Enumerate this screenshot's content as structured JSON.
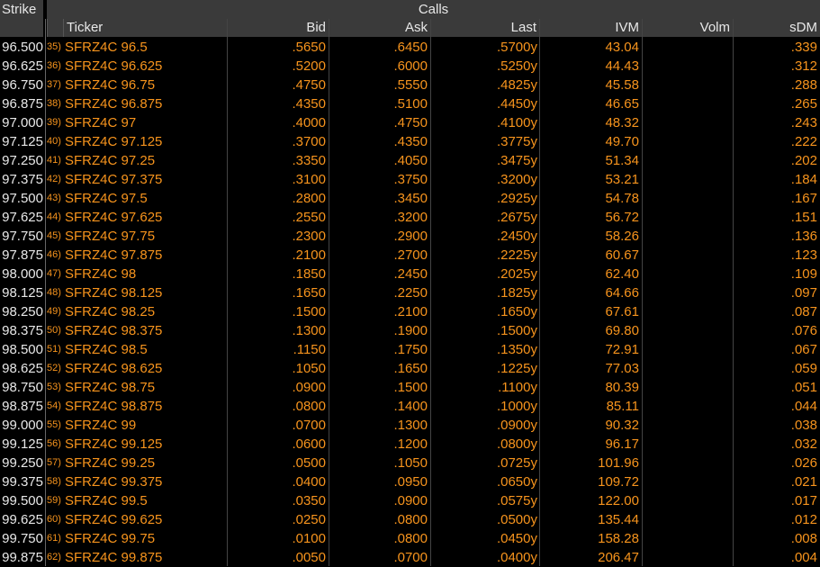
{
  "header": {
    "strike_label": "Strike",
    "calls_label": "Calls",
    "columns": {
      "ticker": "Ticker",
      "bid": "Bid",
      "ask": "Ask",
      "last": "Last",
      "ivm": "IVM",
      "volm": "Volm",
      "sdm": "sDM"
    }
  },
  "colors": {
    "header_bg": "#3a3a3a",
    "data": "#f7941d",
    "strike": "#e8e8e8",
    "background": "#000000"
  },
  "rows": [
    {
      "strike": "96.500",
      "num": "35)",
      "ticker": "SFRZ4C 96.5",
      "bid": ".5650",
      "ask": ".6450",
      "last": ".5700y",
      "ivm": "43.04",
      "volm": "",
      "sdm": ".339"
    },
    {
      "strike": "96.625",
      "num": "36)",
      "ticker": "SFRZ4C 96.625",
      "bid": ".5200",
      "ask": ".6000",
      "last": ".5250y",
      "ivm": "44.43",
      "volm": "",
      "sdm": ".312"
    },
    {
      "strike": "96.750",
      "num": "37)",
      "ticker": "SFRZ4C 96.75",
      "bid": ".4750",
      "ask": ".5550",
      "last": ".4825y",
      "ivm": "45.58",
      "volm": "",
      "sdm": ".288"
    },
    {
      "strike": "96.875",
      "num": "38)",
      "ticker": "SFRZ4C 96.875",
      "bid": ".4350",
      "ask": ".5100",
      "last": ".4450y",
      "ivm": "46.65",
      "volm": "",
      "sdm": ".265"
    },
    {
      "strike": "97.000",
      "num": "39)",
      "ticker": "SFRZ4C 97",
      "bid": ".4000",
      "ask": ".4750",
      "last": ".4100y",
      "ivm": "48.32",
      "volm": "",
      "sdm": ".243"
    },
    {
      "strike": "97.125",
      "num": "40)",
      "ticker": "SFRZ4C 97.125",
      "bid": ".3700",
      "ask": ".4350",
      "last": ".3775y",
      "ivm": "49.70",
      "volm": "",
      "sdm": ".222"
    },
    {
      "strike": "97.250",
      "num": "41)",
      "ticker": "SFRZ4C 97.25",
      "bid": ".3350",
      "ask": ".4050",
      "last": ".3475y",
      "ivm": "51.34",
      "volm": "",
      "sdm": ".202"
    },
    {
      "strike": "97.375",
      "num": "42)",
      "ticker": "SFRZ4C 97.375",
      "bid": ".3100",
      "ask": ".3750",
      "last": ".3200y",
      "ivm": "53.21",
      "volm": "",
      "sdm": ".184"
    },
    {
      "strike": "97.500",
      "num": "43)",
      "ticker": "SFRZ4C 97.5",
      "bid": ".2800",
      "ask": ".3450",
      "last": ".2925y",
      "ivm": "54.78",
      "volm": "",
      "sdm": ".167"
    },
    {
      "strike": "97.625",
      "num": "44)",
      "ticker": "SFRZ4C 97.625",
      "bid": ".2550",
      "ask": ".3200",
      "last": ".2675y",
      "ivm": "56.72",
      "volm": "",
      "sdm": ".151"
    },
    {
      "strike": "97.750",
      "num": "45)",
      "ticker": "SFRZ4C 97.75",
      "bid": ".2300",
      "ask": ".2900",
      "last": ".2450y",
      "ivm": "58.26",
      "volm": "",
      "sdm": ".136"
    },
    {
      "strike": "97.875",
      "num": "46)",
      "ticker": "SFRZ4C 97.875",
      "bid": ".2100",
      "ask": ".2700",
      "last": ".2225y",
      "ivm": "60.67",
      "volm": "",
      "sdm": ".123"
    },
    {
      "strike": "98.000",
      "num": "47)",
      "ticker": "SFRZ4C 98",
      "bid": ".1850",
      "ask": ".2450",
      "last": ".2025y",
      "ivm": "62.40",
      "volm": "",
      "sdm": ".109"
    },
    {
      "strike": "98.125",
      "num": "48)",
      "ticker": "SFRZ4C 98.125",
      "bid": ".1650",
      "ask": ".2250",
      "last": ".1825y",
      "ivm": "64.66",
      "volm": "",
      "sdm": ".097"
    },
    {
      "strike": "98.250",
      "num": "49)",
      "ticker": "SFRZ4C 98.25",
      "bid": ".1500",
      "ask": ".2100",
      "last": ".1650y",
      "ivm": "67.61",
      "volm": "",
      "sdm": ".087"
    },
    {
      "strike": "98.375",
      "num": "50)",
      "ticker": "SFRZ4C 98.375",
      "bid": ".1300",
      "ask": ".1900",
      "last": ".1500y",
      "ivm": "69.80",
      "volm": "",
      "sdm": ".076"
    },
    {
      "strike": "98.500",
      "num": "51)",
      "ticker": "SFRZ4C 98.5",
      "bid": ".1150",
      "ask": ".1750",
      "last": ".1350y",
      "ivm": "72.91",
      "volm": "",
      "sdm": ".067"
    },
    {
      "strike": "98.625",
      "num": "52)",
      "ticker": "SFRZ4C 98.625",
      "bid": ".1050",
      "ask": ".1650",
      "last": ".1225y",
      "ivm": "77.03",
      "volm": "",
      "sdm": ".059"
    },
    {
      "strike": "98.750",
      "num": "53)",
      "ticker": "SFRZ4C 98.75",
      "bid": ".0900",
      "ask": ".1500",
      "last": ".1100y",
      "ivm": "80.39",
      "volm": "",
      "sdm": ".051"
    },
    {
      "strike": "98.875",
      "num": "54)",
      "ticker": "SFRZ4C 98.875",
      "bid": ".0800",
      "ask": ".1400",
      "last": ".1000y",
      "ivm": "85.11",
      "volm": "",
      "sdm": ".044"
    },
    {
      "strike": "99.000",
      "num": "55)",
      "ticker": "SFRZ4C 99",
      "bid": ".0700",
      "ask": ".1300",
      "last": ".0900y",
      "ivm": "90.32",
      "volm": "",
      "sdm": ".038"
    },
    {
      "strike": "99.125",
      "num": "56)",
      "ticker": "SFRZ4C 99.125",
      "bid": ".0600",
      "ask": ".1200",
      "last": ".0800y",
      "ivm": "96.17",
      "volm": "",
      "sdm": ".032"
    },
    {
      "strike": "99.250",
      "num": "57)",
      "ticker": "SFRZ4C 99.25",
      "bid": ".0500",
      "ask": ".1050",
      "last": ".0725y",
      "ivm": "101.96",
      "volm": "",
      "sdm": ".026"
    },
    {
      "strike": "99.375",
      "num": "58)",
      "ticker": "SFRZ4C 99.375",
      "bid": ".0400",
      "ask": ".0950",
      "last": ".0650y",
      "ivm": "109.72",
      "volm": "",
      "sdm": ".021"
    },
    {
      "strike": "99.500",
      "num": "59)",
      "ticker": "SFRZ4C 99.5",
      "bid": ".0350",
      "ask": ".0900",
      "last": ".0575y",
      "ivm": "122.00",
      "volm": "",
      "sdm": ".017"
    },
    {
      "strike": "99.625",
      "num": "60)",
      "ticker": "SFRZ4C 99.625",
      "bid": ".0250",
      "ask": ".0800",
      "last": ".0500y",
      "ivm": "135.44",
      "volm": "",
      "sdm": ".012"
    },
    {
      "strike": "99.750",
      "num": "61)",
      "ticker": "SFRZ4C 99.75",
      "bid": ".0100",
      "ask": ".0800",
      "last": ".0450y",
      "ivm": "158.28",
      "volm": "",
      "sdm": ".008"
    },
    {
      "strike": "99.875",
      "num": "62)",
      "ticker": "SFRZ4C 99.875",
      "bid": ".0050",
      "ask": ".0700",
      "last": ".0400y",
      "ivm": "206.47",
      "volm": "",
      "sdm": ".004"
    }
  ]
}
